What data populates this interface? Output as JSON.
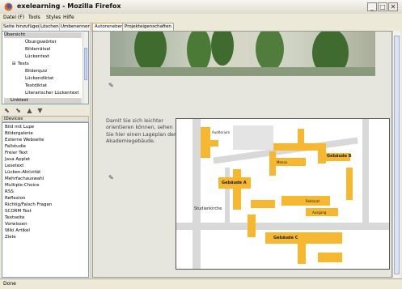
{
  "window": {
    "title": "exelearning - Mozilla Firefox",
    "minimize": "_",
    "maximize": "□",
    "close": "✕"
  },
  "menubar": [
    "Datei (F)",
    "Tools",
    "Styles",
    "Hilfe"
  ],
  "outline_buttons": [
    "Seite hinzufügen",
    "Löschen",
    "Umbenennen"
  ],
  "tree": {
    "root": "Übersicht",
    "items": [
      "Übungswörter",
      "Bilderrätsel",
      "Lückentext",
      "Tests",
      "Bilderquiz",
      "Lückendiktat",
      "Textdiktat",
      "Literarischer Lückentext",
      "Linktest"
    ],
    "selected": "Linktest"
  },
  "idevices_header": "iDevices",
  "idevices": [
    "Bild mit Lupe",
    "Bildergalerie",
    "Externe Webseite",
    "Fallstudie",
    "Freier Text",
    "Java Applet",
    "Lesetext",
    "Lücken-Aktivität",
    "Mehrfachauswahl",
    "Multiple-Choice",
    "RSS",
    "Reflexion",
    "Richtig/Falsch Fragen",
    "SCORM Test",
    "Textseite",
    "Vorwissen",
    "Wiki Artikel",
    "Ziele"
  ],
  "tabs": [
    "Autorenebene",
    "Projekteigenschaften"
  ],
  "content": {
    "description": "Damit Sie sich leichter orientieren können, sehen Sie hier einen Lageplan der Akademiegebäude."
  },
  "map": {
    "buildings": [
      "Gebäude A",
      "Gebäude B",
      "Gebäude C"
    ],
    "labels": [
      "Studienkirche",
      "Auditorium",
      "Mensa",
      "Rektorat",
      "Ausgang"
    ]
  },
  "status": "Done",
  "colors": {
    "tab_active_border": "#e8a84a",
    "building": "#f5b830"
  }
}
